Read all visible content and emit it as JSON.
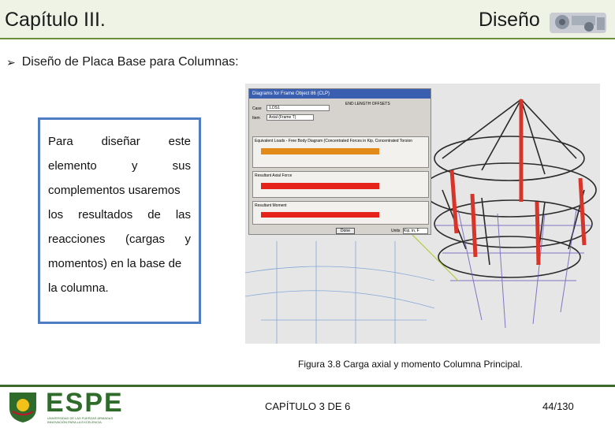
{
  "header": {
    "left_title": "Capítulo III.",
    "right_title": "Diseño"
  },
  "bullet": {
    "text": "Diseño de Placa Base para Columnas:"
  },
  "textbox": {
    "line1": [
      "Para",
      "diseñar",
      "este"
    ],
    "line2": [
      "elemento",
      "y",
      "sus"
    ],
    "line3": "complementos usaremos",
    "line4": [
      "los",
      "resultados",
      "de",
      "las"
    ],
    "line5": [
      "reacciones",
      "(cargas",
      "y"
    ],
    "line6": "momentos) en la base de",
    "line7": "la columna."
  },
  "figure": {
    "dialog_title": "Diagrams for Frame Object 86 (CLP)",
    "case_label": "Case",
    "case_value": "1.DS1",
    "item_label": "Item",
    "item_value": "Axial (Frame T)",
    "end_length_label": "END LENGTH OFFSETS",
    "frame_label": "Equivalent Loads - Free Body Diagram (Concentrated Forces in Kip, Concentrated Torsions in Kip-in)",
    "resultant_label": "Resultant Axial Force",
    "moment_label": "Resultant Moment",
    "units_label": "Units",
    "units_value": "Kip, in, F",
    "done_label": "Done"
  },
  "caption": "Figura 3.8 Carga axial y momento Columna Principal.",
  "footer": {
    "logo_text": "ESPE",
    "logo_subtitle_1": "UNIVERSIDAD DE LAS FUERZAS ARMADAS",
    "logo_subtitle_2": "INNOVACIÓN PARA LA EXCELENCIA",
    "chapter": "CAPÍTULO 3 DE 6",
    "page": "44/130"
  },
  "colors": {
    "header_bg": "#eef3e6",
    "header_rule": "#6a8f3a",
    "textbox_border": "#4e7dc4",
    "logo_green": "#2f6b2a",
    "column_red": "#d8352a"
  }
}
